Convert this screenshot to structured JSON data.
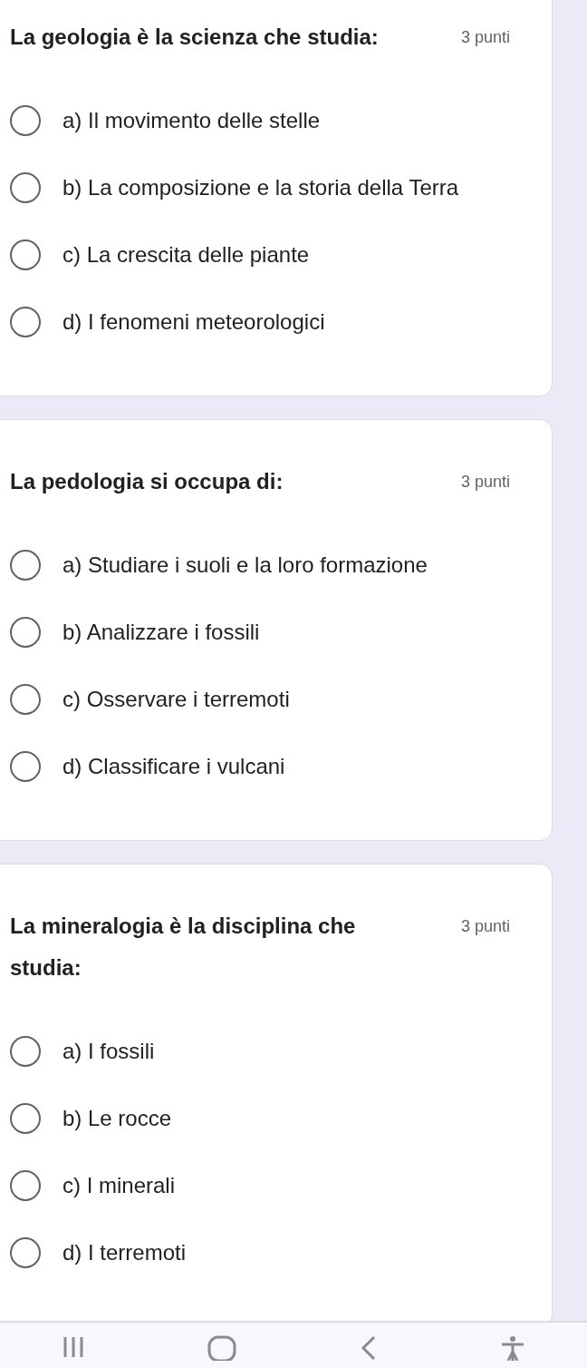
{
  "questions": [
    {
      "title": "La geologia è la scienza che studia:",
      "points": "3 punti",
      "options": [
        {
          "label": "a) Il movimento delle stelle",
          "selected": false
        },
        {
          "label": "b) La composizione e la storia della Terra",
          "selected": false
        },
        {
          "label": "c) La crescita delle piante",
          "selected": false
        },
        {
          "label": "d) I fenomeni meteorologici",
          "selected": false
        }
      ]
    },
    {
      "title": "La pedologia si occupa di:",
      "points": "3 punti",
      "options": [
        {
          "label": "a) Studiare i suoli e la loro formazione",
          "selected": false
        },
        {
          "label": "b) Analizzare i fossili",
          "selected": false
        },
        {
          "label": "c) Osservare i terremoti",
          "selected": false
        },
        {
          "label": "d) Classificare i vulcani",
          "selected": false
        }
      ]
    },
    {
      "title": "La mineralogia è la disciplina che studia:",
      "points": "3 punti",
      "options": [
        {
          "label": "a) I fossili",
          "selected": false
        },
        {
          "label": "b) Le rocce",
          "selected": false
        },
        {
          "label": "c) I minerali",
          "selected": false
        },
        {
          "label": "d) I terremoti",
          "selected": false
        }
      ]
    }
  ]
}
